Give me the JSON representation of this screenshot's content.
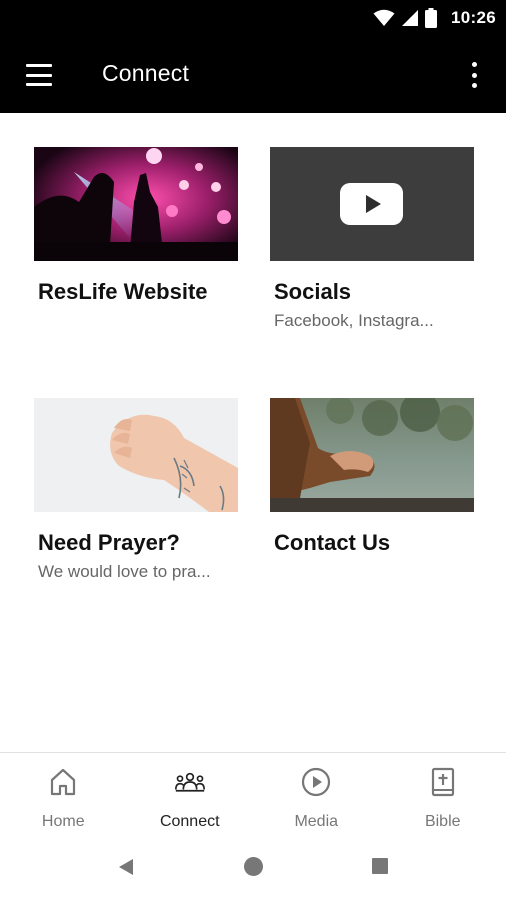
{
  "status_bar": {
    "time": "10:26"
  },
  "app_bar": {
    "title": "Connect",
    "menu_icon": "hamburger-menu-icon",
    "overflow_icon": "more-vertical-icon"
  },
  "tiles": [
    {
      "title": "ResLife Website",
      "subtitle": "",
      "thumbnail": "concert-crowd-photo"
    },
    {
      "title": "Socials",
      "subtitle": "Facebook, Instagra...",
      "thumbnail": "youtube-play-icon"
    },
    {
      "title": "Need Prayer?",
      "subtitle": "We would love to pra...",
      "thumbnail": "praying-hands-photo"
    },
    {
      "title": "Contact Us",
      "subtitle": "",
      "thumbnail": "person-by-lake-photo"
    }
  ],
  "bottom_nav": {
    "active": "Connect",
    "items": [
      {
        "label": "Home",
        "icon": "home-icon"
      },
      {
        "label": "Connect",
        "icon": "people-group-icon"
      },
      {
        "label": "Media",
        "icon": "play-circle-icon"
      },
      {
        "label": "Bible",
        "icon": "bible-icon"
      }
    ]
  },
  "colors": {
    "bar_background": "#000000",
    "active_nav": "#222222",
    "inactive_nav": "#777777"
  }
}
